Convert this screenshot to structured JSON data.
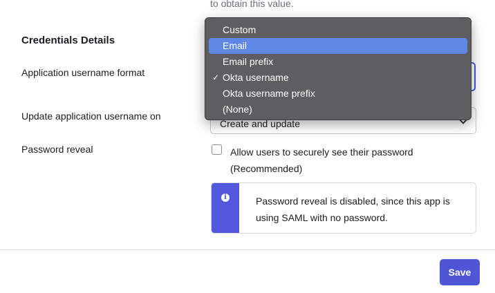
{
  "help_text": "to obtain this value.",
  "section_title": "Credentials Details",
  "fields": {
    "username_format_label": "Application username format",
    "update_label": "Update application username on",
    "update_value": "Create and update",
    "password_reveal_label": "Password reveal"
  },
  "dropdown": {
    "options": [
      {
        "label": "Custom",
        "highlighted": false,
        "checked": false
      },
      {
        "label": "Email",
        "highlighted": true,
        "checked": false
      },
      {
        "label": "Email prefix",
        "highlighted": false,
        "checked": false
      },
      {
        "label": "Okta username",
        "highlighted": false,
        "checked": true
      },
      {
        "label": "Okta username prefix",
        "highlighted": false,
        "checked": false
      },
      {
        "label": "(None)",
        "highlighted": false,
        "checked": false
      }
    ],
    "check_glyph": "✓"
  },
  "checkbox": {
    "label": "Allow users to securely see their password (Recommended)",
    "checked": false
  },
  "callout": {
    "icon": "info-icon",
    "icon_glyph": "i",
    "text": "Password reveal is disabled, since this app is using SAML with no password.",
    "accent_color": "#5158dc"
  },
  "footer": {
    "save_label": "Save",
    "save_color": "#4f56d6"
  }
}
